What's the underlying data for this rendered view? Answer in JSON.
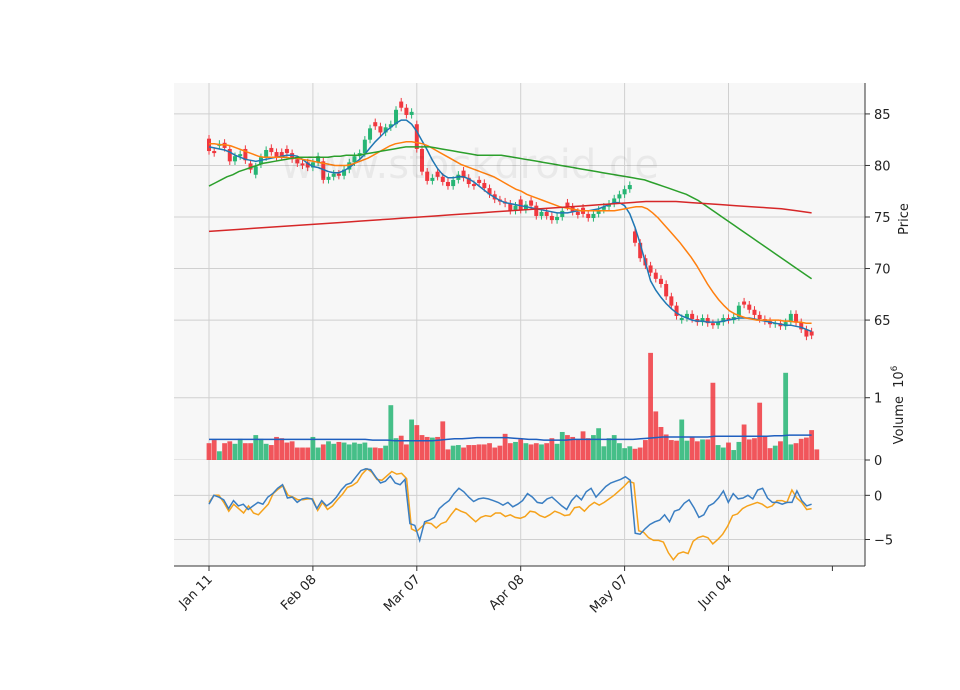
{
  "chart_data": {
    "type": "candlestick",
    "watermark": "www.stockdroid.de",
    "x_ticks": [
      "Jan 11",
      "Feb 08",
      "Mar 07",
      "Apr 08",
      "May 07",
      "Jun 04"
    ],
    "x_tick_index": [
      0,
      20,
      40,
      60,
      80,
      100
    ],
    "colors": {
      "up": "#26b574",
      "down": "#f0383f",
      "ma_blue": "#1f77b4",
      "ma_orange": "#ff7f0e",
      "ma_green": "#2ca02c",
      "ma_red": "#d62728",
      "vol_ma": "#1f5fbf",
      "osc_line1": "#3a7ec2",
      "osc_line2": "#f5a21b",
      "panel_bg": "#f7f7f7",
      "grid": "#d0d0d0"
    },
    "price_panel": {
      "ylabel": "Price",
      "ylim": [
        62,
        88
      ],
      "yticks": [
        65,
        70,
        75,
        80,
        85
      ]
    },
    "volume_panel": {
      "ylabel": "Volume  10^6",
      "ylim": [
        0,
        1.75
      ],
      "yticks": [
        0,
        1
      ],
      "ytick_labels": [
        "0",
        "1"
      ]
    },
    "osc_panel": {
      "ylim": [
        -8,
        4
      ],
      "yticks": [
        0,
        -5
      ],
      "ytick_labels": [
        "0",
        "−5"
      ]
    },
    "ohlc_close": [
      81.4,
      81.2,
      82.1,
      81.7,
      80.4,
      80.9,
      81.1,
      80.5,
      79.6,
      79.9,
      80.8,
      81.5,
      81.3,
      80.8,
      80.9,
      81.2,
      80.6,
      80.2,
      80.0,
      79.8,
      80.3,
      80.9,
      78.6,
      78.9,
      79.2,
      79.0,
      79.6,
      80.3,
      80.9,
      81.2,
      82.5,
      83.6,
      83.8,
      83.2,
      83.7,
      84.0,
      85.4,
      85.6,
      84.9,
      85.2,
      81.6,
      79.4,
      78.5,
      78.8,
      78.9,
      78.4,
      78.0,
      78.6,
      79.1,
      78.8,
      78.2,
      78.0,
      78.3,
      77.8,
      77.2,
      76.7,
      76.5,
      76.3,
      75.6,
      76.1,
      75.7,
      76.2,
      76.1,
      75.1,
      75.5,
      75.1,
      74.7,
      75.0,
      75.6,
      76.0,
      75.5,
      75.2,
      75.3,
      74.9,
      75.3,
      75.7,
      76.0,
      76.3,
      76.8,
      77.2,
      77.7,
      78.1,
      72.5,
      71.0,
      70.3,
      69.6,
      69.0,
      68.5,
      67.3,
      66.4,
      65.4,
      65.2,
      65.6,
      65.1,
      64.8,
      65.2,
      64.7,
      64.5,
      64.8,
      65.2,
      65.0,
      65.3,
      66.4,
      66.5,
      66.0,
      65.5,
      65.1,
      64.9,
      64.6,
      64.7,
      64.4,
      64.8,
      65.6,
      64.8,
      64.1,
      63.4,
      63.5
    ],
    "ohlc_open": [
      82.6,
      81.4,
      81.9,
      82.2,
      81.6,
      80.4,
      80.9,
      81.6,
      80.2,
      79.1,
      80.1,
      80.8,
      81.7,
      81.3,
      81.3,
      81.6,
      81.2,
      80.6,
      80.2,
      80.3,
      79.8,
      80.3,
      80.4,
      78.6,
      78.9,
      79.2,
      79.0,
      79.6,
      80.3,
      80.9,
      81.2,
      82.5,
      84.2,
      83.8,
      83.2,
      83.7,
      84.0,
      86.2,
      85.6,
      84.9,
      84.0,
      81.6,
      79.4,
      78.5,
      79.4,
      78.9,
      78.4,
      78.0,
      78.6,
      79.5,
      78.8,
      78.2,
      78.6,
      78.3,
      77.8,
      77.2,
      76.7,
      76.5,
      76.3,
      75.6,
      76.7,
      75.7,
      76.6,
      76.1,
      75.1,
      75.5,
      75.1,
      74.7,
      75.0,
      76.4,
      76.0,
      75.5,
      75.9,
      75.3,
      74.9,
      75.3,
      75.7,
      76.0,
      76.3,
      76.8,
      77.2,
      77.7,
      73.6,
      72.5,
      71.0,
      70.3,
      69.6,
      69.0,
      68.5,
      67.3,
      66.4,
      65.0,
      65.2,
      65.6,
      65.1,
      64.8,
      65.2,
      64.7,
      64.5,
      64.8,
      65.2,
      65.0,
      65.3,
      66.8,
      66.5,
      66.0,
      65.5,
      65.1,
      64.9,
      64.6,
      64.7,
      64.4,
      64.8,
      65.6,
      64.8,
      64.1,
      63.9
    ],
    "ma_blue": [
      81.8,
      81.7,
      81.6,
      81.5,
      81.3,
      81.0,
      80.8,
      80.6,
      80.5,
      80.4,
      80.5,
      80.6,
      80.7,
      80.8,
      80.9,
      81.0,
      81.0,
      80.9,
      80.6,
      80.2,
      79.9,
      79.8,
      79.6,
      79.4,
      79.3,
      79.3,
      79.5,
      79.8,
      80.2,
      80.6,
      81.1,
      81.7,
      82.3,
      82.8,
      83.3,
      83.7,
      84.1,
      84.4,
      84.4,
      84.0,
      83.3,
      82.4,
      81.5,
      80.5,
      79.7,
      79.1,
      78.8,
      78.8,
      78.9,
      78.9,
      78.7,
      78.4,
      78.0,
      77.6,
      77.2,
      76.9,
      76.6,
      76.4,
      76.3,
      76.2,
      76.1,
      76.0,
      75.9,
      75.8,
      75.7,
      75.6,
      75.5,
      75.4,
      75.4,
      75.4,
      75.5,
      75.6,
      75.6,
      75.6,
      75.7,
      75.8,
      76.0,
      76.2,
      76.4,
      76.4,
      76.1,
      75.3,
      74.0,
      72.4,
      70.6,
      68.8,
      67.9,
      67.2,
      66.6,
      66.1,
      65.7,
      65.4,
      65.2,
      65.0,
      64.9,
      64.9,
      64.8,
      64.8,
      64.8,
      64.9,
      65.0,
      65.1,
      65.2,
      65.2,
      65.2,
      65.1,
      65.0,
      64.9,
      64.8,
      64.7,
      64.6,
      64.5,
      64.5,
      64.4,
      64.3,
      64.1,
      63.9
    ],
    "ma_orange": [
      82.1,
      82.1,
      82.0,
      82.0,
      81.9,
      81.7,
      81.5,
      81.3,
      81.1,
      80.9,
      80.8,
      80.8,
      80.8,
      80.8,
      80.8,
      80.7,
      80.7,
      80.6,
      80.5,
      80.4,
      80.3,
      80.2,
      80.1,
      80.0,
      80.0,
      80.0,
      80.1,
      80.3,
      80.5,
      80.7,
      81.0,
      81.3,
      81.6,
      81.9,
      82.1,
      82.2,
      82.3,
      82.3,
      82.2,
      82.1,
      81.9,
      81.6,
      81.3,
      81.0,
      80.7,
      80.4,
      80.1,
      79.9,
      79.7,
      79.5,
      79.3,
      79.1,
      78.9,
      78.6,
      78.3,
      78.0,
      77.7,
      77.5,
      77.2,
      77.0,
      76.8,
      76.6,
      76.4,
      76.2,
      76.0,
      75.9,
      75.8,
      75.7,
      75.6,
      75.6,
      75.6,
      75.6,
      75.6,
      75.6,
      75.6,
      75.7,
      75.8,
      75.9,
      76.0,
      76.0,
      75.8,
      75.4,
      74.9,
      74.3,
      73.7,
      73.1,
      72.5,
      71.8,
      71.1,
      70.3,
      69.4,
      68.5,
      67.7,
      67.0,
      66.4,
      65.9,
      65.6,
      65.4,
      65.2,
      65.1,
      65.0,
      65.0,
      65.0,
      65.0,
      65.0,
      64.9,
      64.9,
      64.8,
      64.8,
      64.7,
      64.7
    ],
    "ma_green": [
      78.0,
      78.3,
      78.6,
      78.9,
      79.1,
      79.4,
      79.6,
      79.8,
      80.0,
      80.2,
      80.3,
      80.4,
      80.5,
      80.6,
      80.7,
      80.8,
      80.8,
      80.8,
      80.8,
      80.8,
      80.8,
      80.9,
      80.9,
      81.0,
      81.0,
      81.0,
      81.1,
      81.2,
      81.3,
      81.4,
      81.5,
      81.6,
      81.7,
      81.8,
      81.8,
      81.8,
      81.8,
      81.8,
      81.7,
      81.6,
      81.5,
      81.4,
      81.3,
      81.2,
      81.1,
      81.0,
      81.0,
      81.0,
      81.0,
      81.0,
      80.9,
      80.8,
      80.7,
      80.6,
      80.5,
      80.4,
      80.3,
      80.2,
      80.1,
      80.0,
      79.9,
      79.8,
      79.7,
      79.6,
      79.5,
      79.4,
      79.3,
      79.2,
      79.1,
      79.0,
      78.9,
      78.8,
      78.7,
      78.6,
      78.4,
      78.2,
      78.0,
      77.8,
      77.6,
      77.4,
      77.2,
      76.9,
      76.6,
      76.2,
      75.8,
      75.4,
      75.0,
      74.6,
      74.2,
      73.8,
      73.4,
      73.0,
      72.6,
      72.2,
      71.8,
      71.4,
      71.0,
      70.6,
      70.2,
      69.8,
      69.4,
      69.0
    ],
    "ma_red": [
      73.6,
      73.7,
      73.8,
      73.9,
      74.0,
      74.1,
      74.2,
      74.3,
      74.4,
      74.5,
      74.6,
      74.7,
      74.8,
      74.9,
      75.0,
      75.1,
      75.2,
      75.3,
      75.4,
      75.5,
      75.6,
      75.7,
      75.8,
      75.9,
      76.0,
      76.1,
      76.2,
      76.3,
      76.4,
      76.5,
      76.5,
      76.5,
      76.4,
      76.3,
      76.2,
      76.1,
      76.0,
      75.9,
      75.8,
      75.6,
      75.4
    ],
    "volume": [
      0.27,
      0.32,
      0.14,
      0.27,
      0.3,
      0.26,
      0.34,
      0.27,
      0.27,
      0.4,
      0.34,
      0.26,
      0.24,
      0.37,
      0.35,
      0.28,
      0.3,
      0.2,
      0.2,
      0.2,
      0.37,
      0.2,
      0.25,
      0.3,
      0.26,
      0.29,
      0.28,
      0.25,
      0.28,
      0.26,
      0.28,
      0.2,
      0.2,
      0.19,
      0.23,
      0.88,
      0.35,
      0.39,
      0.25,
      0.65,
      0.56,
      0.4,
      0.37,
      0.36,
      0.37,
      0.62,
      0.17,
      0.23,
      0.24,
      0.2,
      0.24,
      0.24,
      0.25,
      0.25,
      0.27,
      0.2,
      0.23,
      0.42,
      0.27,
      0.29,
      0.33,
      0.27,
      0.25,
      0.27,
      0.25,
      0.27,
      0.35,
      0.26,
      0.45,
      0.4,
      0.37,
      0.33,
      0.46,
      0.35,
      0.4,
      0.51,
      0.22,
      0.35,
      0.4,
      0.27,
      0.19,
      0.22,
      0.18,
      0.2,
      0.32,
      1.72,
      0.78,
      0.53,
      0.41,
      0.32,
      0.31,
      0.65,
      0.31,
      0.37,
      0.3,
      0.33,
      0.33,
      1.24,
      0.24,
      0.2,
      0.28,
      0.16,
      0.29,
      0.57,
      0.33,
      0.35,
      0.92,
      0.37,
      0.19,
      0.23,
      0.3,
      1.4,
      0.25,
      0.27,
      0.34,
      0.36,
      0.48,
      0.17
    ],
    "volume_ma": [
      0.33,
      0.33,
      0.33,
      0.33,
      0.33,
      0.33,
      0.33,
      0.33,
      0.33,
      0.33,
      0.33,
      0.33,
      0.33,
      0.33,
      0.33,
      0.33,
      0.33,
      0.33,
      0.33,
      0.33,
      0.33,
      0.33,
      0.32,
      0.32,
      0.32,
      0.31,
      0.31,
      0.31,
      0.31,
      0.31,
      0.31,
      0.32,
      0.33,
      0.34,
      0.34,
      0.35,
      0.36,
      0.36,
      0.36,
      0.36,
      0.36,
      0.35,
      0.34,
      0.33,
      0.33,
      0.32,
      0.32,
      0.32,
      0.32,
      0.33,
      0.33,
      0.33,
      0.33,
      0.33,
      0.33,
      0.33,
      0.33,
      0.33,
      0.34,
      0.35,
      0.36,
      0.37,
      0.37,
      0.37,
      0.37,
      0.37,
      0.37,
      0.37,
      0.38,
      0.38,
      0.38,
      0.38,
      0.38,
      0.38,
      0.38,
      0.38,
      0.39,
      0.39,
      0.4,
      0.4,
      0.4,
      0.4
    ],
    "osc_line1": [
      -1.0,
      0.0,
      -0.2,
      -0.5,
      -1.5,
      -0.6,
      -1.2,
      -1.0,
      -1.6,
      -1.2,
      -0.8,
      -1.0,
      -0.2,
      0.2,
      0.8,
      1.2,
      -0.3,
      -0.2,
      -0.8,
      -0.4,
      -0.3,
      -0.4,
      -1.5,
      -0.6,
      -1.2,
      -0.8,
      -0.2,
      0.6,
      1.2,
      1.4,
      2.1,
      2.8,
      3.0,
      2.9,
      2.1,
      1.4,
      1.6,
      2.2,
      1.4,
      1.2,
      1.8,
      -3.2,
      -3.4,
      -5.1,
      -3.0,
      -2.8,
      -2.5,
      -1.5,
      -1.0,
      -0.6,
      0.2,
      0.8,
      0.4,
      -0.2,
      -0.7,
      -0.4,
      -0.3,
      -0.4,
      -0.6,
      -0.8,
      -1.1,
      -0.8,
      -1.3,
      -1.0,
      -0.6,
      0.2,
      -0.2,
      -0.8,
      -0.9,
      -0.4,
      -0.2,
      -0.7,
      -1.2,
      -1.6,
      -0.6,
      0.0,
      -0.5,
      0.4,
      0.8,
      -0.2,
      0.4,
      1.0,
      1.4,
      1.6,
      1.8,
      2.1,
      1.7,
      -4.3,
      -4.4,
      -3.8,
      -3.3,
      -3.0,
      -2.8,
      -2.2,
      -3.0,
      -1.8,
      -1.6,
      -0.9,
      -0.5,
      -1.4,
      -2.5,
      -2.2,
      -1.2,
      -0.9,
      -0.3,
      0.5,
      -0.8,
      0.2,
      -0.4,
      -0.3,
      0.0,
      -0.4,
      0.6,
      0.8,
      -0.3,
      -0.8,
      -0.8,
      -1.0,
      -0.8,
      -0.8,
      0.5,
      -0.6,
      -1.2,
      -1.0
    ],
    "osc_line2": [
      -0.8,
      0.0,
      0.0,
      -0.8,
      -1.8,
      -1.0,
      -1.5,
      -2.0,
      -1.2,
      -2.0,
      -2.2,
      -1.6,
      -1.0,
      0.2,
      0.7,
      1.1,
      0.0,
      -0.2,
      -0.5,
      -0.5,
      -0.4,
      -0.4,
      -1.7,
      -0.8,
      -1.6,
      -1.2,
      -0.5,
      0.1,
      0.9,
      1.1,
      1.5,
      2.4,
      3.0,
      2.6,
      1.8,
      1.7,
      2.2,
      2.7,
      2.4,
      2.5,
      1.9,
      -3.8,
      -4.1,
      -3.6,
      -3.1,
      -3.2,
      -3.7,
      -3.2,
      -3.0,
      -2.2,
      -1.5,
      -1.8,
      -2.0,
      -2.5,
      -3.0,
      -2.5,
      -2.3,
      -2.4,
      -2.0,
      -2.0,
      -2.4,
      -2.2,
      -2.5,
      -2.6,
      -2.4,
      -1.8,
      -1.9,
      -2.3,
      -2.5,
      -2.2,
      -1.8,
      -2.0,
      -2.3,
      -2.2,
      -1.4,
      -1.3,
      -1.8,
      -1.2,
      -0.8,
      -1.1,
      -0.8,
      -0.4,
      0.0,
      0.5,
      1.0,
      1.6,
      1.4,
      -4.0,
      -4.2,
      -4.8,
      -5.1,
      -5.1,
      -5.3,
      -6.5,
      -7.3,
      -6.6,
      -6.4,
      -6.6,
      -5.2,
      -4.8,
      -4.6,
      -4.8,
      -5.5,
      -5.0,
      -4.4,
      -3.5,
      -2.3,
      -2.1,
      -1.5,
      -1.2,
      -1.0,
      -0.8,
      -1.0,
      -1.4,
      -1.2,
      -0.6,
      -0.6,
      -0.8,
      0.6,
      -0.3,
      -0.8,
      -1.6,
      -1.5
    ]
  }
}
